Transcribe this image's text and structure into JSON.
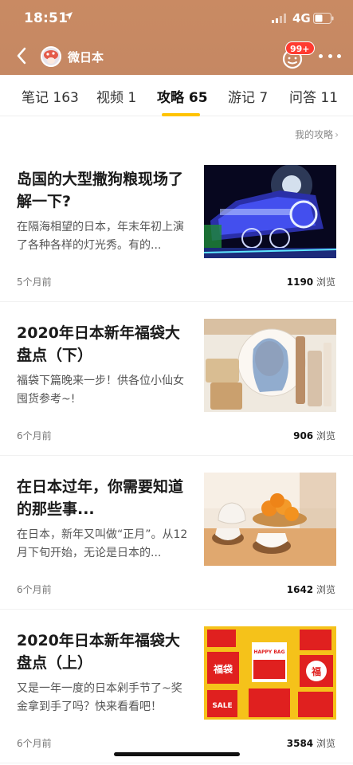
{
  "status": {
    "time": "18:51",
    "network": "4G"
  },
  "nav": {
    "title": "微日本",
    "badge": "99+"
  },
  "tabs": [
    {
      "label": "笔记 163"
    },
    {
      "label": "视频 1"
    },
    {
      "label": "攻略 65",
      "active": true
    },
    {
      "label": "游记 7"
    },
    {
      "label": "问答 11"
    }
  ],
  "my_guides": "我的攻略",
  "articles": [
    {
      "title": "岛国的大型撒狗粮现场了解一下?",
      "desc": "在隔海相望的日本，年末年初上演了各种各样的灯光秀。有的...",
      "time": "5个月前",
      "views": "1190",
      "views_unit": "浏览",
      "image": "illuminated-train-photo"
    },
    {
      "title": "2020年日本新年福袋大盘点（下）",
      "desc": "福袋下篇晚来一步！供各位小仙女囤货参考~!",
      "time": "6个月前",
      "views": "906",
      "views_unit": "浏览",
      "image": "cosmetics-illustration-photo"
    },
    {
      "title": "在日本过年，你需要知道的那些事...",
      "desc": "在日本，新年又叫做“正月”。从12月下旬开始，无论是日本的...",
      "time": "6个月前",
      "views": "1642",
      "views_unit": "浏览",
      "image": "tea-and-oranges-photo"
    },
    {
      "title": "2020年日本新年福袋大盘点（上）",
      "desc": "又是一年一度的日本剁手节了~奖金拿到手了吗？快来看看吧！",
      "time": "6个月前",
      "views": "3584",
      "views_unit": "浏览",
      "image": "lucky-bags-illustration",
      "image_text": {
        "happy_bag": "HAPPY BAG",
        "fukubukuro": "福袋",
        "fuku": "福",
        "sale": "SALE"
      }
    }
  ]
}
